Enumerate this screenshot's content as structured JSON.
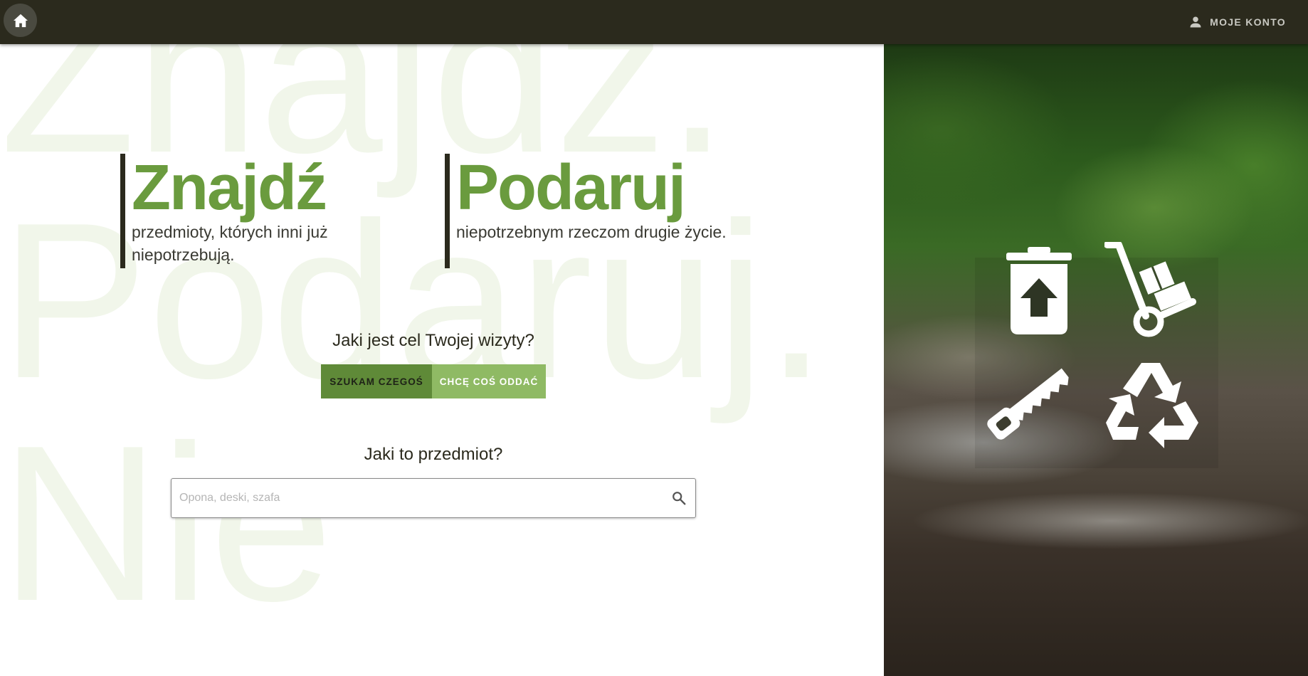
{
  "topbar": {
    "home_icon": "home-icon",
    "account_icon": "person-icon",
    "account_label": "MOJE KONTO"
  },
  "background_words": [
    "Znajdź.",
    "Podaruj.",
    "Nie"
  ],
  "headlines": {
    "find": {
      "title": "Znajdź",
      "subtitle_line1": "przedmioty, których inni już",
      "subtitle_line2": "niepotrzebują."
    },
    "give": {
      "title": "Podaruj",
      "subtitle": "niepotrzebnym rzeczom drugie życie."
    }
  },
  "visit_question": "Jaki jest cel Twojej wizyty?",
  "visit_options": {
    "seek_label": "SZUKAM CZEGOŚ",
    "give_label": "CHCĘ COŚ ODDAĆ",
    "selected": "seek"
  },
  "item_question": "Jaki to przedmiot?",
  "search": {
    "placeholder": "Opona, deski, szafa",
    "value": "",
    "icon": "search-icon"
  },
  "photo_panel": {
    "icons": [
      "trash-upload-icon",
      "hand-truck-icon",
      "saw-icon",
      "recycle-icon"
    ]
  },
  "colors": {
    "topbar": "#2b2a1d",
    "accent_green": "#6a9b3e",
    "button_dark": "#5f8a38",
    "button_light": "#8fba64"
  }
}
